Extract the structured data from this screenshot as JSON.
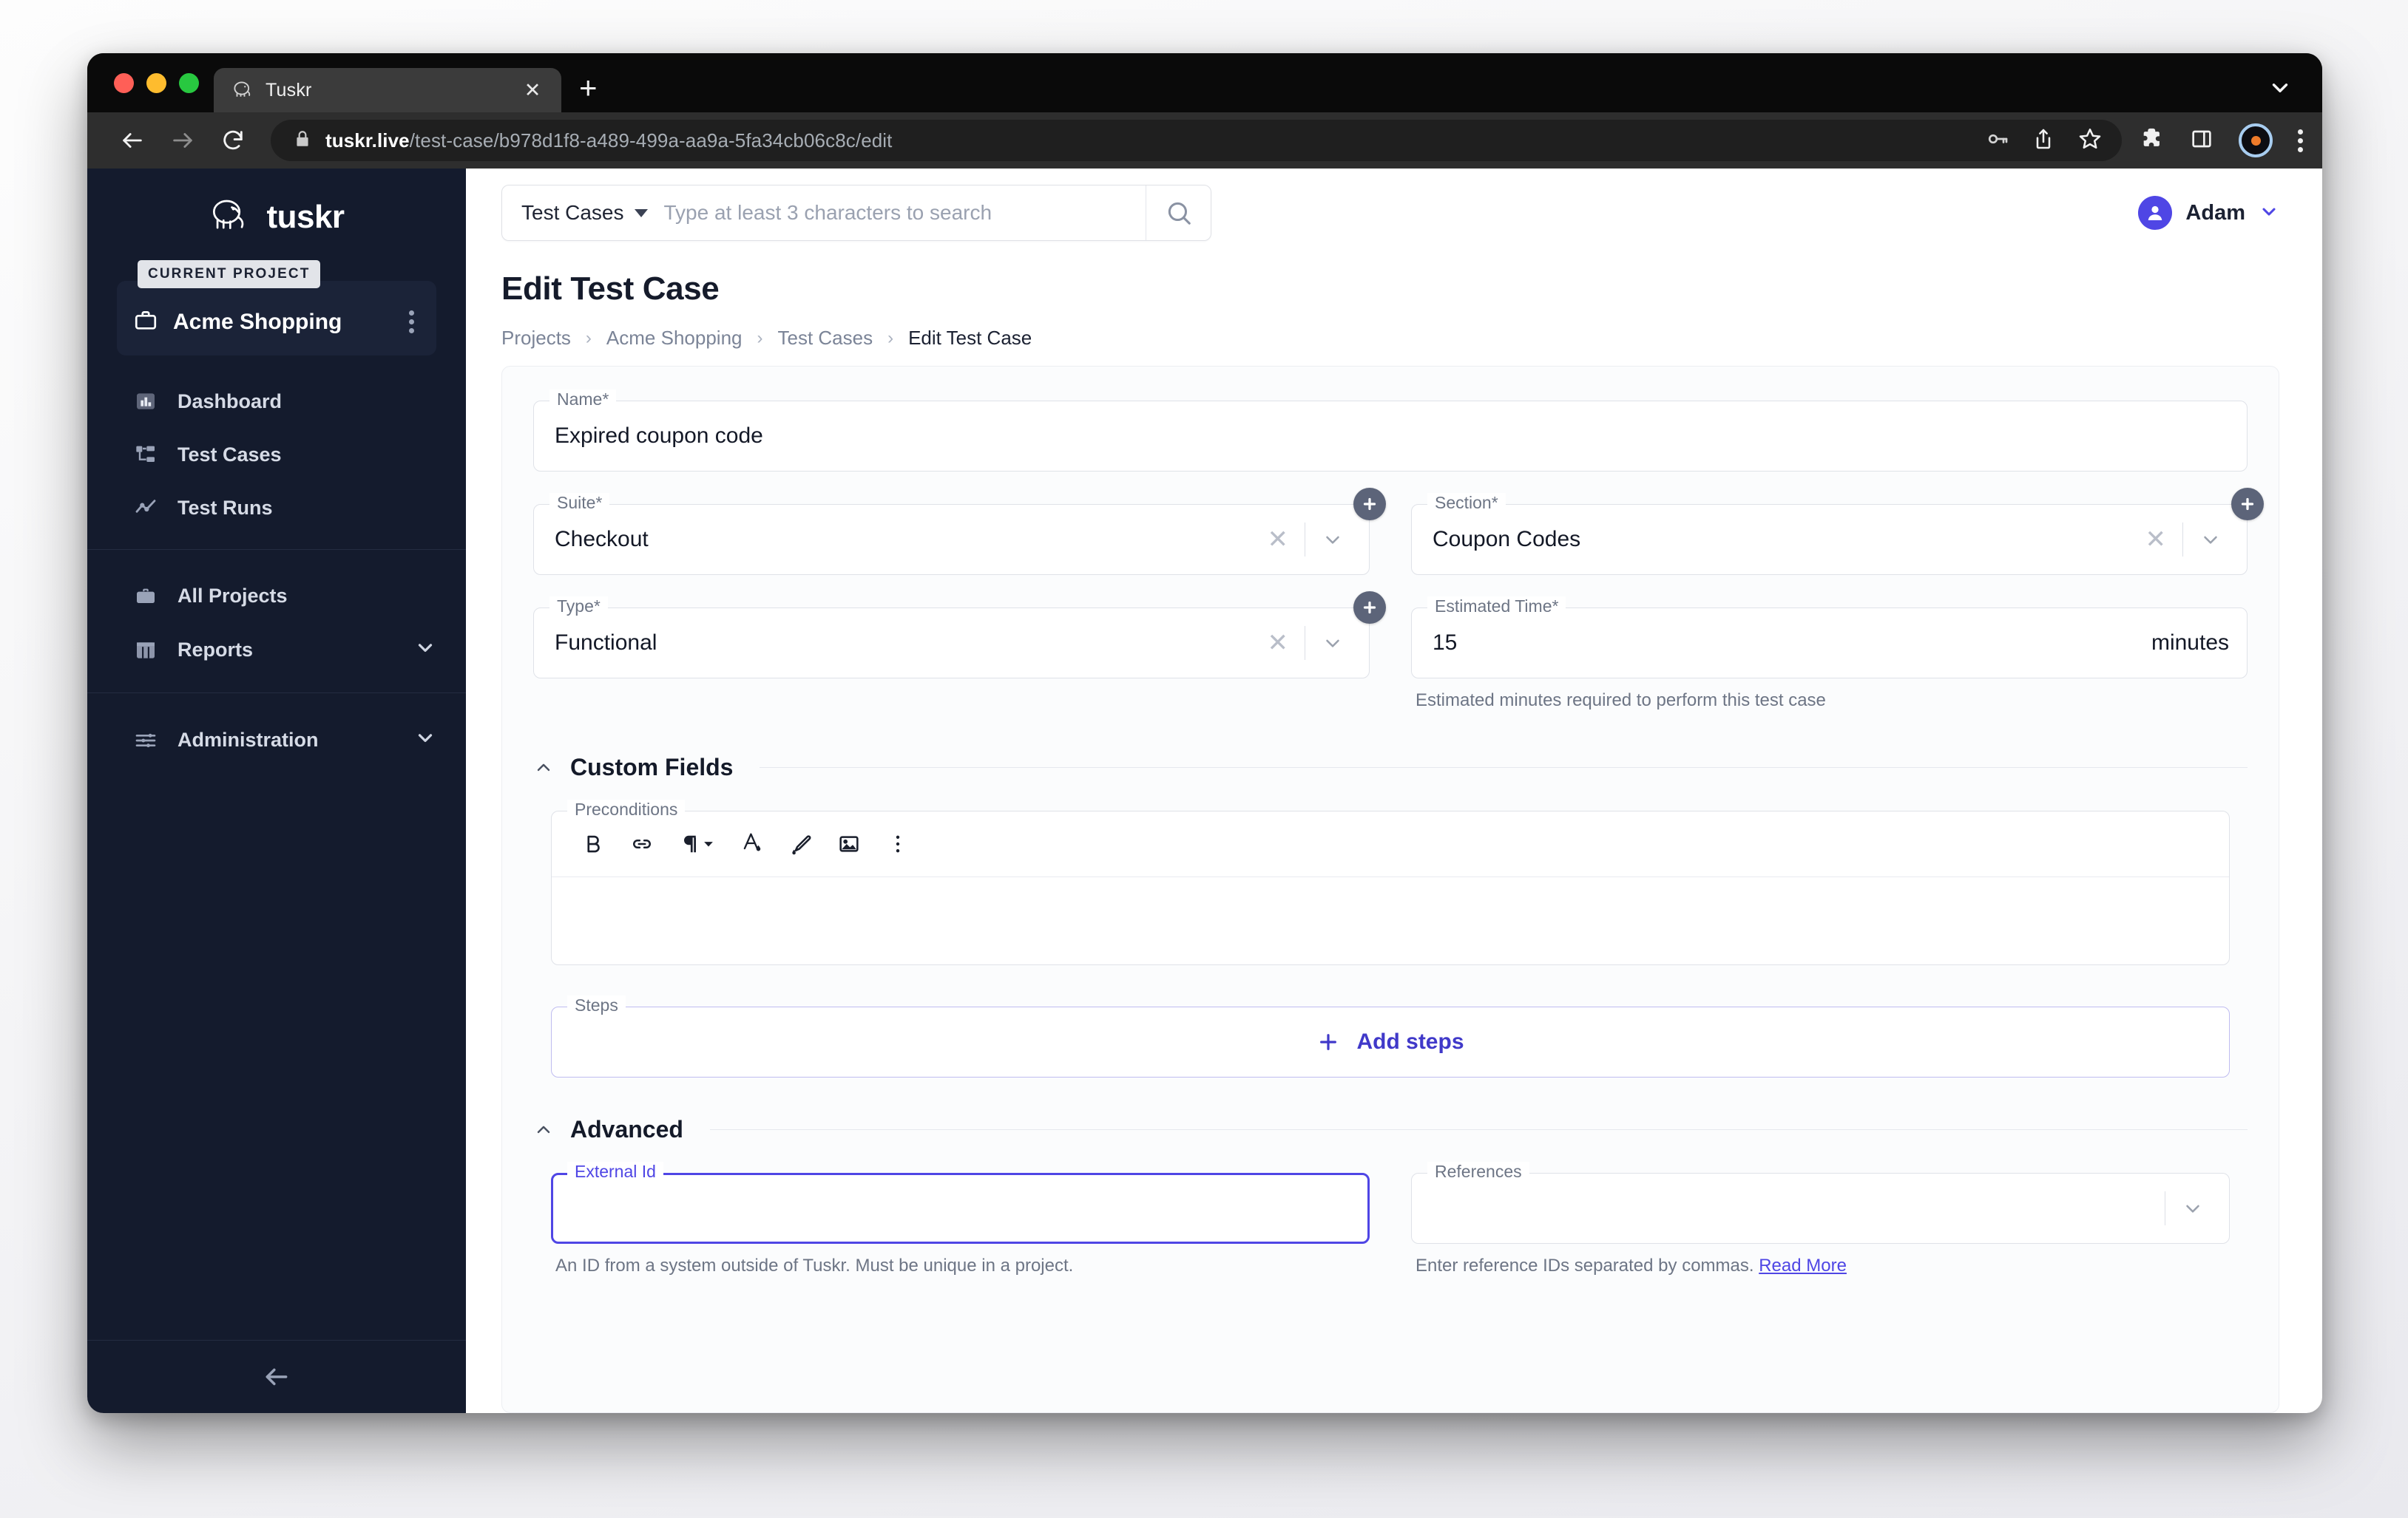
{
  "browser": {
    "tab": {
      "title": "Tuskr",
      "favicon_icon": "elephant-icon",
      "close_icon": "close-icon"
    },
    "new_tab_icon": "plus-icon",
    "tabstrip_menu_icon": "chevron-down-icon",
    "nav": {
      "back_icon": "arrow-left-icon",
      "forward_icon": "arrow-right-icon",
      "reload_icon": "reload-icon"
    },
    "url": {
      "lock_icon": "lock-icon",
      "domain": "tuskr.live",
      "path": "/test-case/b978d1f8-a489-499a-aa9a-5fa34cb06c8c/edit",
      "full": "tuskr.live/test-case/b978d1f8-a489-499a-aa9a-5fa34cb06c8c/edit"
    },
    "omni_actions": [
      "key-icon",
      "share-icon",
      "bookmark-star-icon"
    ],
    "toolbar_icons": [
      "extensions-puzzle-icon",
      "side-panel-icon",
      "profile-avatar-icon",
      "browser-menu-kebab-icon"
    ]
  },
  "sidebar": {
    "brand": {
      "name": "tuskr",
      "logo_icon": "elephant-logo-icon"
    },
    "current_project": {
      "tag": "CURRENT PROJECT",
      "name": "Acme Shopping",
      "icon": "briefcase-icon",
      "menu_icon": "vertical-kebab-icon"
    },
    "project_nav": [
      {
        "label": "Dashboard",
        "icon": "bar-chart-icon"
      },
      {
        "label": "Test Cases",
        "icon": "sitemap-icon"
      },
      {
        "label": "Test Runs",
        "icon": "trend-line-icon"
      }
    ],
    "global_nav": [
      {
        "label": "All Projects",
        "icon": "briefcase-icon",
        "chevron": false
      },
      {
        "label": "Reports",
        "icon": "reports-columns-icon",
        "chevron": true
      }
    ],
    "admin_nav": [
      {
        "label": "Administration",
        "icon": "sliders-icon",
        "chevron": true
      }
    ],
    "collapse_icon": "arrow-left-icon"
  },
  "topbar": {
    "search_scope": "Test Cases",
    "search_scope_caret_icon": "caret-down-icon",
    "search_placeholder": "Type at least 3 characters to search",
    "search_value": "",
    "search_icon": "search-icon",
    "user": {
      "name": "Adam",
      "avatar_icon": "user-avatar-icon",
      "chevron_icon": "chevron-down-icon"
    }
  },
  "page": {
    "title": "Edit Test Case",
    "breadcrumbs": [
      "Projects",
      "Acme Shopping",
      "Test Cases",
      "Edit Test Case"
    ],
    "breadcrumb_separator": "›"
  },
  "form": {
    "name": {
      "label": "Name*",
      "value": "Expired coupon code"
    },
    "suite": {
      "label": "Suite*",
      "value": "Checkout",
      "clear_icon": "close-x-icon",
      "chevron_icon": "chevron-down-icon",
      "add_icon": "plus-circle-icon"
    },
    "section": {
      "label": "Section*",
      "value": "Coupon Codes",
      "clear_icon": "close-x-icon",
      "chevron_icon": "chevron-down-icon",
      "add_icon": "plus-circle-icon"
    },
    "type": {
      "label": "Type*",
      "value": "Functional",
      "clear_icon": "close-x-icon",
      "chevron_icon": "chevron-down-icon",
      "add_icon": "plus-circle-icon"
    },
    "estimated_time": {
      "label": "Estimated Time*",
      "value": "15",
      "suffix": "minutes",
      "helper": "Estimated minutes required to perform this test case"
    }
  },
  "custom_fields": {
    "section_title": "Custom Fields",
    "collapse_icon": "chevron-up-icon",
    "preconditions": {
      "label": "Preconditions",
      "value": "",
      "toolbar": [
        {
          "name": "bold-icon",
          "glyph": "B"
        },
        {
          "name": "link-icon",
          "glyph": ""
        },
        {
          "name": "paragraph-icon",
          "glyph": "¶"
        },
        {
          "name": "text-color-icon",
          "glyph": "A"
        },
        {
          "name": "highlighter-icon",
          "glyph": ""
        },
        {
          "name": "image-icon",
          "glyph": ""
        },
        {
          "name": "more-options-kebab-icon",
          "glyph": ""
        }
      ]
    },
    "steps": {
      "label": "Steps",
      "add_label": "Add steps",
      "add_icon": "plus-icon"
    }
  },
  "advanced": {
    "section_title": "Advanced",
    "collapse_icon": "chevron-up-icon",
    "external_id": {
      "label": "External Id",
      "value": "",
      "focused": true,
      "helper": "An ID from a system outside of Tuskr. Must be unique in a project."
    },
    "references": {
      "label": "References",
      "value": "",
      "chevron_icon": "chevron-down-icon",
      "helper": "Enter reference IDs separated by commas.",
      "helper_link": "Read More"
    }
  },
  "colors": {
    "accent": "#4f46e5",
    "sidebar_bg": "#141b2d",
    "page_bg": "#ffffff",
    "link": "#4039c9"
  }
}
